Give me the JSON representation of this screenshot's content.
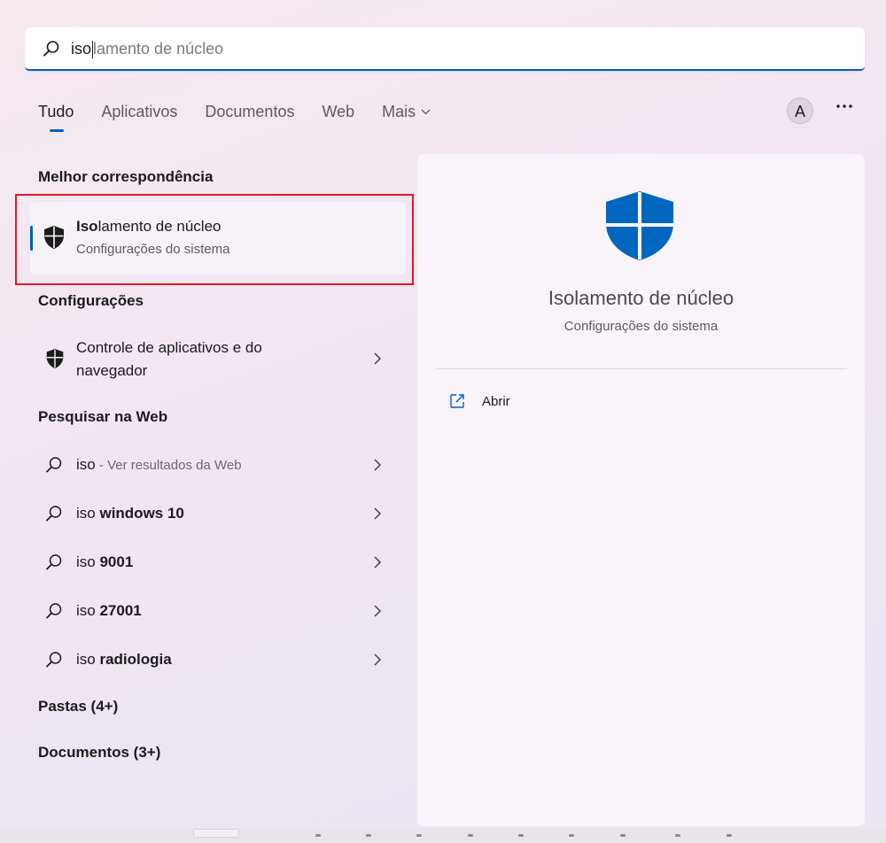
{
  "search": {
    "typed": "iso",
    "completion": "lamento de núcleo"
  },
  "tabs": [
    {
      "label": "Tudo",
      "active": true
    },
    {
      "label": "Aplicativos",
      "active": false
    },
    {
      "label": "Documentos",
      "active": false
    },
    {
      "label": "Web",
      "active": false
    },
    {
      "label": "Mais",
      "active": false,
      "has_dropdown": true
    }
  ],
  "account": {
    "avatar_letter": "A"
  },
  "more_icon": "ellipsis-icon",
  "best_match": {
    "section_title": "Melhor correspondência",
    "title_bold": "Iso",
    "title_rest": "lamento de núcleo",
    "subtitle": "Configurações do sistema",
    "icon": "shield-icon"
  },
  "settings": {
    "section_title": "Configurações",
    "items": [
      {
        "line1": "Controle de aplicativos e do",
        "line2": "navegador",
        "icon": "shield-icon"
      }
    ]
  },
  "web": {
    "section_title": "Pesquisar na Web",
    "items": [
      {
        "prefix": "iso",
        "bold": "",
        "sub": " - Ver resultados da Web"
      },
      {
        "prefix": "iso ",
        "bold": "windows 10",
        "sub": ""
      },
      {
        "prefix": "iso ",
        "bold": "9001",
        "sub": ""
      },
      {
        "prefix": "iso ",
        "bold": "27001",
        "sub": ""
      },
      {
        "prefix": "iso ",
        "bold": "radiologia",
        "sub": ""
      }
    ]
  },
  "folders": {
    "section_title": "Pastas (4+)"
  },
  "documents": {
    "section_title": "Documentos (3+)"
  },
  "detail": {
    "title": "Isolamento de núcleo",
    "subtitle": "Configurações do sistema",
    "actions": [
      {
        "label": "Abrir",
        "icon": "open-external-icon"
      }
    ]
  },
  "colors": {
    "accent": "#005fb8",
    "shield_blue": "#0067c0",
    "highlight_outline": "#e01b24"
  }
}
